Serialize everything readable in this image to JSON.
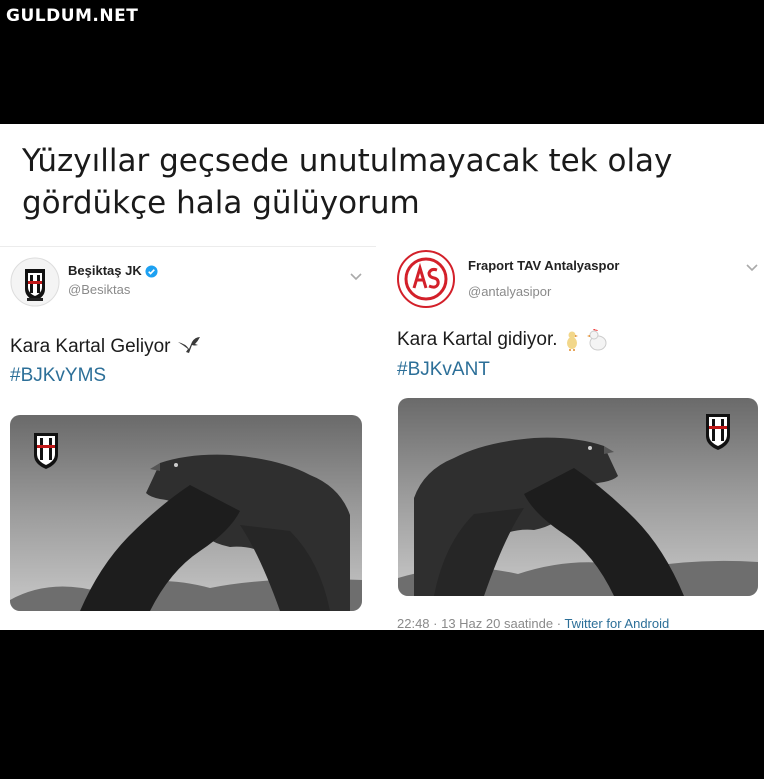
{
  "watermark": "GULDUM.NET",
  "caption": {
    "line1": "Yüzyıllar geçsede unutulmayacak tek olay",
    "line2": "gördükçe hala gülüyorum"
  },
  "tweets": [
    {
      "account_name": "Beşiktaş JK",
      "handle": "@Besiktas",
      "verified": true,
      "text": "Kara Kartal Geliyor",
      "hashtag": "#BJKvYMS",
      "icons": [
        "bjk-crest-icon",
        "verified-badge-icon",
        "chevron-down-icon",
        "eagle-emoji-icon"
      ]
    },
    {
      "account_name": "Fraport TAV Antalyaspor",
      "handle": "@antalyasipor",
      "verified": false,
      "text": "Kara Kartal gidiyor.",
      "hashtag": "#BJKvANT",
      "time": "22:48 · 13 Haz 20 saatinde ·",
      "via": "Twitter for Android",
      "icons": [
        "antalyaspor-crest-icon",
        "chevron-down-icon",
        "chick-emoji-icon",
        "hen-emoji-icon"
      ]
    }
  ],
  "colors": {
    "background": "#000000",
    "panel": "#ffffff",
    "hashtag": "#2c6f98",
    "verified": "#1da1f2",
    "antalyaspor_red": "#d3202a"
  }
}
